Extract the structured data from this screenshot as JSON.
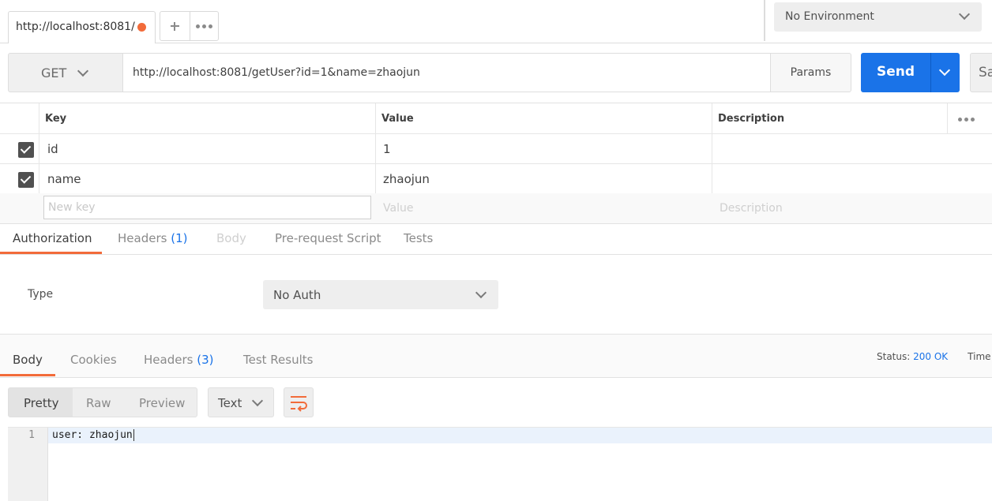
{
  "tab_bar": {
    "request_tab_label": "http://localhost:8081/",
    "unsaved_indicator_color": "#f26b3a",
    "new_tab_icon": "plus-icon",
    "more_tabs_icon": "more-dots-icon"
  },
  "environment": {
    "selected": "No Environment"
  },
  "request": {
    "method": "GET",
    "url": "http://localhost:8081/getUser?id=1&name=zhaojun",
    "params_label": "Params",
    "send_label": "Send",
    "save_label": "Sa",
    "accent_color": "#1a73e8"
  },
  "params_table": {
    "headers": [
      "Key",
      "Value",
      "Description"
    ],
    "rows": [
      {
        "checked": true,
        "key": "id",
        "value": "1",
        "description": ""
      },
      {
        "checked": true,
        "key": "name",
        "value": "zhaojun",
        "description": ""
      }
    ],
    "new_row": {
      "key_placeholder": "New key",
      "value_placeholder": "Value",
      "description_placeholder": "Description"
    }
  },
  "request_tabs": [
    {
      "label": "Authorization",
      "count": "",
      "state": "active"
    },
    {
      "label": "Headers",
      "count": "(1)",
      "state": "normal"
    },
    {
      "label": "Body",
      "count": "",
      "state": "disabled"
    },
    {
      "label": "Pre-request Script",
      "count": "",
      "state": "normal"
    },
    {
      "label": "Tests",
      "count": "",
      "state": "normal"
    }
  ],
  "auth": {
    "type_label": "Type",
    "selected": "No Auth"
  },
  "response": {
    "tabs": [
      {
        "label": "Body",
        "count": "",
        "state": "active"
      },
      {
        "label": "Cookies",
        "count": "",
        "state": "normal"
      },
      {
        "label": "Headers",
        "count": "(3)",
        "state": "normal"
      },
      {
        "label": "Test Results",
        "count": "",
        "state": "normal"
      }
    ],
    "status_label": "Status:",
    "status_value": "200 OK",
    "time_label": "Time",
    "view_modes": [
      "Pretty",
      "Raw",
      "Preview"
    ],
    "format": "Text",
    "wrap_icon": "wrap-lines-icon",
    "body_lines": [
      {
        "number": "1",
        "text": "user: zhaojun"
      }
    ]
  }
}
